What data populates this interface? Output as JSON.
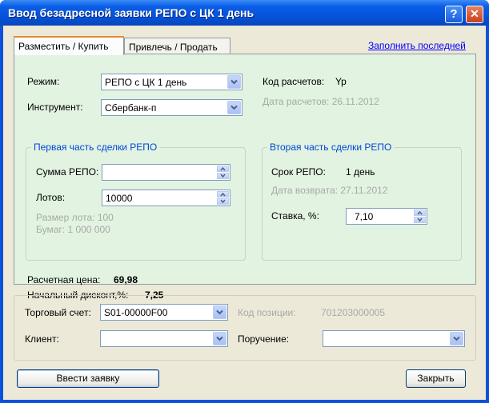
{
  "window": {
    "title": "Ввод безадресной заявки РЕПО с ЦК 1 день",
    "help_glyph": "?",
    "close_glyph": "✕"
  },
  "tabs": [
    {
      "label": "Разместить / Купить",
      "active": true
    },
    {
      "label": "Привлечь / Продать",
      "active": false
    }
  ],
  "fill_last_link": "Заполнить последней",
  "main": {
    "mode_label": "Режим:",
    "mode_value": "РЕПО с ЦК 1 день",
    "instrument_label": "Инструмент:",
    "instrument_value": "Сбербанк-п",
    "settle_code_label": "Код расчетов:",
    "settle_code_value": "Yp",
    "settle_date_text": "Дата расчетов: 26.11.2012"
  },
  "first_part": {
    "title": "Первая часть сделки РЕПО",
    "sum_label": "Сумма РЕПО:",
    "sum_value": "",
    "lots_label": "Лотов:",
    "lots_value": "10000",
    "lot_size_text": "Размер лота: 100",
    "securities_text": "Бумаг: 1 000 000"
  },
  "second_part": {
    "title": "Вторая часть сделки РЕПО",
    "term_label": "Срок РЕПО:",
    "term_value": "1 день",
    "return_date_text": "Дата возврата: 27.11.2012",
    "rate_label": "Ставка, %:",
    "rate_value": "7,10"
  },
  "summary": {
    "price_label": "Расчетная цена:",
    "price_value": "69,98",
    "discount_label": "Начальный дисконт,%:",
    "discount_value": "7,25"
  },
  "account": {
    "trade_account_label": "Торговый счет:",
    "trade_account_value": "S01-00000F00",
    "position_code_label": "Код позиции:",
    "position_code_value": "701203000005",
    "client_label": "Клиент:",
    "client_value": "",
    "order_label": "Поручение:",
    "order_value": ""
  },
  "buttons": {
    "submit": "Ввести заявку",
    "close": "Закрыть"
  },
  "icons": {
    "dropdown": "chevron-down-icon",
    "spin_up": "chevron-up-icon",
    "spin_down": "chevron-down-icon"
  },
  "colors": {
    "titlebar": "#0550d9",
    "panel_bg": "#e2f3e2",
    "group_title": "#0046d5",
    "link": "#0000ff",
    "dialog_bg": "#ece9d8"
  }
}
